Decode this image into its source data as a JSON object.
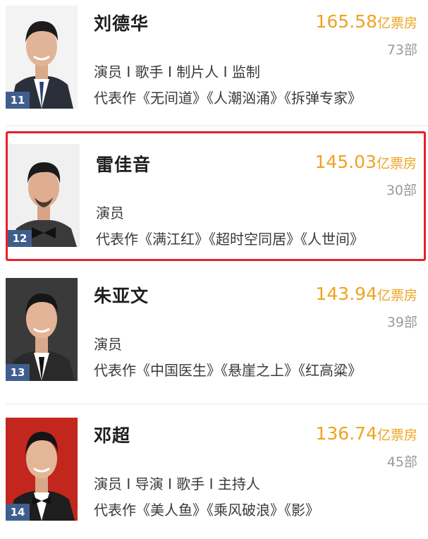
{
  "accent_color": "#efa31f",
  "rank_badge_color": "#3f5e8c",
  "highlight_color": "#e8202a",
  "stars": [
    {
      "rank": "11",
      "name": "刘德华",
      "box_value": "165.58",
      "box_unit": "亿票房",
      "film_count": "73部",
      "roles": "演员 I 歌手 I 制片人 I 监制",
      "works": "代表作《无间道》《人潮汹涌》《拆弹专家》",
      "photo_bg": "#f3f3f3"
    },
    {
      "rank": "12",
      "name": "雷佳音",
      "box_value": "145.03",
      "box_unit": "亿票房",
      "film_count": "30部",
      "roles": "演员",
      "works": "代表作《满江红》《超时空同居》《人世间》",
      "photo_bg": "#f0f0f0"
    },
    {
      "rank": "13",
      "name": "朱亚文",
      "box_value": "143.94",
      "box_unit": "亿票房",
      "film_count": "39部",
      "roles": "演员",
      "works": "代表作《中国医生》《悬崖之上》《红高粱》",
      "photo_bg": "#3a3a3a"
    },
    {
      "rank": "14",
      "name": "邓超",
      "box_value": "136.74",
      "box_unit": "亿票房",
      "film_count": "45部",
      "roles": "演员 I 导演 I 歌手 I 主持人",
      "works": "代表作《美人鱼》《乘风破浪》《影》",
      "photo_bg": "#c2261d"
    }
  ]
}
